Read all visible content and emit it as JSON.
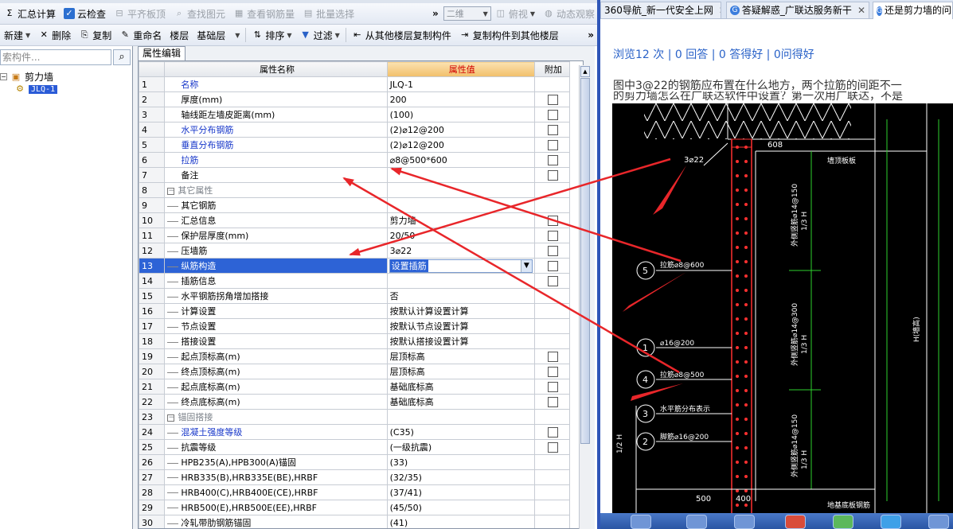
{
  "toolbar1": {
    "items": [
      "汇总计算",
      "云检查",
      "平齐板顶",
      "查找图元",
      "查看钢筋量",
      "批量选择"
    ],
    "view_mode": "二维",
    "view_angle": "俯视",
    "dynamic": "动态观察"
  },
  "toolbar2": {
    "items": [
      "新建",
      "删除",
      "复制",
      "重命名",
      "楼层",
      "基础层",
      "排序",
      "过滤",
      "从其他楼层复制构件",
      "复制构件到其他楼层"
    ]
  },
  "left_panel": {
    "search_placeholder": "索构件...",
    "tree_root": "剪力墙",
    "tree_child": "JLQ-1"
  },
  "editor": {
    "tab": "属性编辑",
    "columns": [
      "属性名称",
      "属性值",
      "附加"
    ],
    "rows": [
      {
        "n": "1",
        "name": "名称",
        "value": "JLQ-1",
        "style": "blue",
        "check": false
      },
      {
        "n": "2",
        "name": "厚度(mm)",
        "value": "200",
        "style": "",
        "check": true
      },
      {
        "n": "3",
        "name": "轴线距左墙皮距离(mm)",
        "value": "(100)",
        "style": "",
        "check": true
      },
      {
        "n": "4",
        "name": "水平分布钢筋",
        "value": "(2)⌀12@200",
        "style": "blue",
        "check": true
      },
      {
        "n": "5",
        "name": "垂直分布钢筋",
        "value": "(2)⌀12@200",
        "style": "blue",
        "check": true
      },
      {
        "n": "6",
        "name": "拉筋",
        "value": "⌀8@500*600",
        "style": "blue",
        "check": true
      },
      {
        "n": "7",
        "name": "备注",
        "value": "",
        "style": "",
        "check": true
      },
      {
        "n": "8",
        "name": "其它属性",
        "value": "",
        "style": "group",
        "check": false
      },
      {
        "n": "9",
        "name": "其它钢筋",
        "value": "",
        "style": "child",
        "check": false
      },
      {
        "n": "10",
        "name": "汇总信息",
        "value": "剪力墙",
        "style": "child",
        "check": true
      },
      {
        "n": "11",
        "name": "保护层厚度(mm)",
        "value": "20/50",
        "style": "child",
        "check": true
      },
      {
        "n": "12",
        "name": "压墙筋",
        "value": "3⌀22",
        "style": "child",
        "check": true
      },
      {
        "n": "13",
        "name": "纵筋构造",
        "value": "设置插筋",
        "style": "selected",
        "check": true
      },
      {
        "n": "14",
        "name": "插筋信息",
        "value": "",
        "style": "child",
        "check": true
      },
      {
        "n": "15",
        "name": "水平钢筋拐角增加搭接",
        "value": "否",
        "style": "child",
        "check": false
      },
      {
        "n": "16",
        "name": "计算设置",
        "value": "按默认计算设置计算",
        "style": "child",
        "check": false
      },
      {
        "n": "17",
        "name": "节点设置",
        "value": "按默认节点设置计算",
        "style": "child",
        "check": false
      },
      {
        "n": "18",
        "name": "搭接设置",
        "value": "按默认搭接设置计算",
        "style": "child",
        "check": false
      },
      {
        "n": "19",
        "name": "起点顶标高(m)",
        "value": "层顶标高",
        "style": "child",
        "check": true
      },
      {
        "n": "20",
        "name": "终点顶标高(m)",
        "value": "层顶标高",
        "style": "child",
        "check": true
      },
      {
        "n": "21",
        "name": "起点底标高(m)",
        "value": "基础底标高",
        "style": "child",
        "check": true
      },
      {
        "n": "22",
        "name": "终点底标高(m)",
        "value": "基础底标高",
        "style": "child",
        "check": true
      },
      {
        "n": "23",
        "name": "锚固搭接",
        "value": "",
        "style": "group",
        "check": false
      },
      {
        "n": "24",
        "name": "混凝土强度等级",
        "value": "(C35)",
        "style": "childblue",
        "check": true
      },
      {
        "n": "25",
        "name": "抗震等级",
        "value": "(一级抗震)",
        "style": "child",
        "check": true
      },
      {
        "n": "26",
        "name": "HPB235(A),HPB300(A)锚固",
        "value": "(33)",
        "style": "child",
        "check": false
      },
      {
        "n": "27",
        "name": "HRB335(B),HRB335E(BE),HRBF",
        "value": "(32/35)",
        "style": "child",
        "check": false
      },
      {
        "n": "28",
        "name": "HRB400(C),HRB400E(CE),HRBF",
        "value": "(37/41)",
        "style": "child",
        "check": false
      },
      {
        "n": "29",
        "name": "HRB500(E),HRB500E(EE),HRBF",
        "value": "(45/50)",
        "style": "child",
        "check": false
      },
      {
        "n": "30",
        "name": "冷轧带肋钢筋锚固",
        "value": "(41)",
        "style": "child",
        "check": false
      }
    ]
  },
  "browser": {
    "tabs": [
      "360导航_新一代安全上网",
      "答疑解惑_广联达服务新干",
      "还是剪力墙的问"
    ],
    "stats": "浏览12 次 | 0 回答 | 0 答得好 | 0问得好",
    "question": "图中3@22的钢筋应布置在什么地方，两个拉筋的间距不一",
    "question_line2": "的剪力墙怎么在广联达软件中设置？第一次用广联达，不是"
  },
  "drawing": {
    "labels": {
      "top_dim": "608",
      "top_bar": "3⌀22",
      "top_note": "墙顶板板",
      "lbl5": "拉筋⌀8@600",
      "lbl1": "⌀16@200",
      "lbl4": "拉筋⌀8@500",
      "lbl3": "水平筋分布表示",
      "lbl2": "脚筋⌀16@200",
      "bottom_dim1": "500",
      "bottom_dim2": "400",
      "bottom_note": "地基底板钢筋",
      "vert1": "外侧竖筋⌀14@150",
      "vert2": "外侧竖筋⌀14@300",
      "vert3": "外侧竖筋⌀14@150",
      "vtag1": "1/3 H",
      "vtag2": "1/3 H",
      "vtag3": "1/3 H",
      "right_note": "H(墙高)",
      "left_note": "1/2 H"
    },
    "circles": [
      "5",
      "1",
      "4",
      "3",
      "2"
    ]
  },
  "colors": {
    "accent": "#2d63d6",
    "header_value": "#f1bf6a",
    "arrow": "#e8262a",
    "rebar": "#ff3030"
  }
}
